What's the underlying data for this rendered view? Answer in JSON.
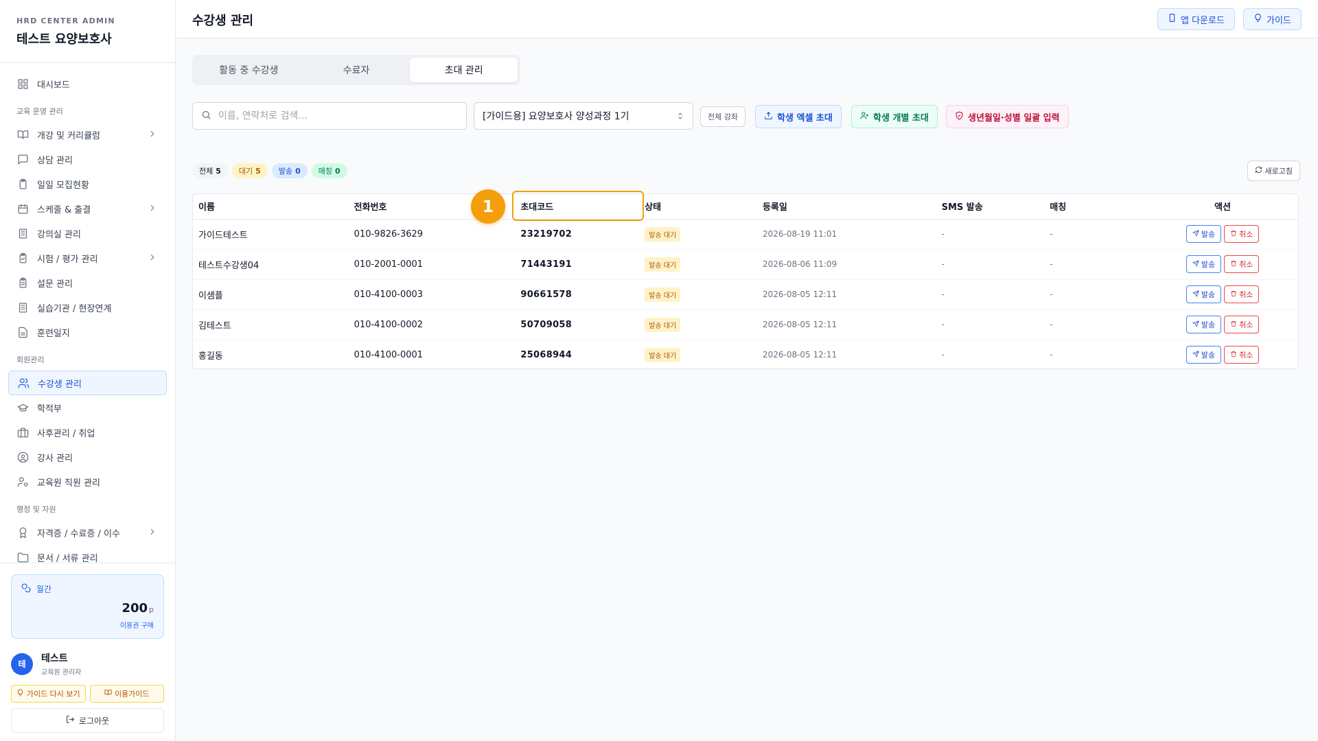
{
  "brand": {
    "subtitle": "HRD CENTER ADMIN",
    "title": "테스트 요양보호사"
  },
  "sidebar": {
    "items": [
      {
        "label": "대시보드",
        "icon": "dashboard-icon"
      },
      {
        "section": "교육 운영 관리"
      },
      {
        "label": "개강 및 커리큘럼",
        "icon": "book-icon",
        "chevron": true
      },
      {
        "label": "상담 관리",
        "icon": "chat-icon"
      },
      {
        "label": "일일 모집현황",
        "icon": "clipboard-icon"
      },
      {
        "label": "스케줄 & 출결",
        "icon": "calendar-icon",
        "chevron": true
      },
      {
        "label": "강의실 관리",
        "icon": "building-icon"
      },
      {
        "label": "시험 / 평가 관리",
        "icon": "clipboard-check-icon",
        "chevron": true
      },
      {
        "label": "설문 관리",
        "icon": "clipboard-list-icon"
      },
      {
        "label": "실습기관 / 현장연계",
        "icon": "building-icon"
      },
      {
        "label": "훈련일지",
        "icon": "document-icon"
      },
      {
        "section": "회원관리"
      },
      {
        "label": "수강생 관리",
        "icon": "users-icon",
        "active": true
      },
      {
        "label": "학적부",
        "icon": "graduation-cap-icon"
      },
      {
        "label": "사후관리 / 취업",
        "icon": "briefcase-icon"
      },
      {
        "label": "강사 관리",
        "icon": "user-circle-icon"
      },
      {
        "label": "교육원 직원 관리",
        "icon": "user-cog-icon"
      },
      {
        "section": "행정 및 자원"
      },
      {
        "label": "자격증 / 수료증 / 이수",
        "icon": "award-icon",
        "chevron": true
      },
      {
        "label": "문서 / 서류 관리",
        "icon": "folder-icon"
      }
    ],
    "credit": {
      "label": "월간",
      "amount": "200",
      "unit": "p",
      "link": "이용권 구매"
    },
    "user": {
      "avatar": "테",
      "name": "테스트",
      "role": "교육원 관리자"
    },
    "guide_again": "가이드 다시 보기",
    "usage_guide": "이용가이드",
    "logout": "로그아웃"
  },
  "header": {
    "title": "수강생 관리",
    "app_download": "앱 다운로드",
    "guide": "가이드"
  },
  "tabs": [
    {
      "label": "활동 중 수강생",
      "active": false
    },
    {
      "label": "수료자",
      "active": false
    },
    {
      "label": "초대 관리",
      "active": true
    }
  ],
  "toolbar": {
    "search_placeholder": "이름, 연락처로 검색...",
    "course_select": "[가이드용] 요양보호사 양성과정 1기",
    "all_courses": "전체 강좌",
    "excel_invite": "학생 엑셀 초대",
    "single_invite": "학생 개별 초대",
    "bulk_input": "생년월일·성별 일괄 입력"
  },
  "counts": [
    {
      "label": "전체",
      "value": "5"
    },
    {
      "label": "대기",
      "value": "5"
    },
    {
      "label": "발송",
      "value": "0"
    },
    {
      "label": "매칭",
      "value": "0"
    }
  ],
  "refresh": "새로고침",
  "table": {
    "columns": [
      "이름",
      "전화번호",
      "초대코드",
      "상태",
      "등록일",
      "SMS 발송",
      "매칭",
      "액션"
    ],
    "rows": [
      {
        "name": "가이드테스트",
        "phone": "010-9826-3629",
        "code": "23219702",
        "status": "발송 대기",
        "date": "2026-08-19 11:01",
        "sms": "-",
        "match": "-"
      },
      {
        "name": "테스트수강생04",
        "phone": "010-2001-0001",
        "code": "71443191",
        "status": "발송 대기",
        "date": "2026-08-06 11:09",
        "sms": "-",
        "match": "-"
      },
      {
        "name": "이샘플",
        "phone": "010-4100-0003",
        "code": "90661578",
        "status": "발송 대기",
        "date": "2026-08-05 12:11",
        "sms": "-",
        "match": "-"
      },
      {
        "name": "김테스트",
        "phone": "010-4100-0002",
        "code": "50709058",
        "status": "발송 대기",
        "date": "2026-08-05 12:11",
        "sms": "-",
        "match": "-"
      },
      {
        "name": "홍길동",
        "phone": "010-4100-0001",
        "code": "25068944",
        "status": "발송 대기",
        "date": "2026-08-05 12:11",
        "sms": "-",
        "match": "-"
      }
    ],
    "send_label": "발송",
    "cancel_label": "취소"
  },
  "annotation": {
    "number": "1",
    "color": "#f59e0b"
  }
}
